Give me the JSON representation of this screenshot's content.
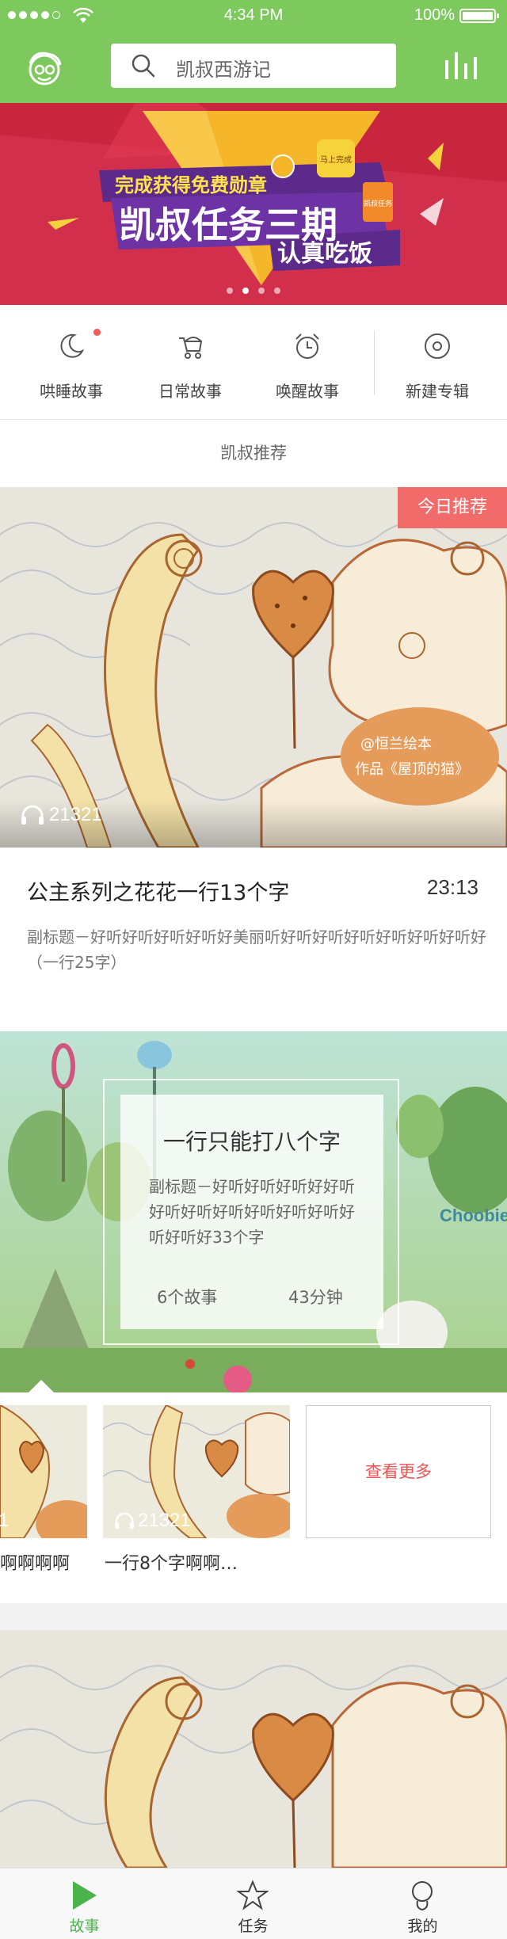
{
  "status_bar": {
    "time": "4:34 PM",
    "battery": "100%"
  },
  "header": {
    "search_placeholder": "凯叔西游记"
  },
  "banner": {
    "line1": "完成获得免费勋章",
    "line2": "凯叔任务三期",
    "line3": "认真吃饭",
    "tag_top": "马上完成",
    "tag_side": "凯叔任务",
    "active_dot": 1,
    "dot_count": 4
  },
  "categories": [
    {
      "label": "哄睡故事",
      "icon": "moon-icon"
    },
    {
      "label": "日常故事",
      "icon": "stroller-icon"
    },
    {
      "label": "唤醒故事",
      "icon": "alarm-clock-icon"
    },
    {
      "label": "新建专辑",
      "icon": "disc-icon"
    }
  ],
  "section_title": "凯叔推荐",
  "featured": {
    "badge": "今日推荐",
    "plays": "21321",
    "title": "公主系列之花花一行13个字",
    "duration": "23:13",
    "subtitle": "副标题－好听好听好听好听好美丽听好听好听好听好听好听好听好（一行25字）",
    "art_caption_1": "@恒兰绘本",
    "art_caption_2": "作品《屋顶的猫》"
  },
  "album": {
    "title": "一行只能打八个字",
    "subtitle": "副标题－好听好听好听好好听好听好听好听好听好听好听好听好听好33个字",
    "count": "6个故事",
    "duration": "43分钟",
    "watermark": "Choobie",
    "items": [
      {
        "title": "啊啊啊啊",
        "plays": "1"
      },
      {
        "title": "一行8个字啊啊…",
        "plays": "21321"
      }
    ],
    "more_label": "查看更多"
  },
  "tabs": [
    {
      "label": "故事",
      "icon": "play-icon",
      "active": true
    },
    {
      "label": "任务",
      "icon": "star-icon",
      "active": false
    },
    {
      "label": "我的",
      "icon": "user-icon",
      "active": false
    }
  ],
  "colors": {
    "primary": "#7dc95e",
    "accent": "#f26b6b",
    "banner": "#d22f4c"
  }
}
